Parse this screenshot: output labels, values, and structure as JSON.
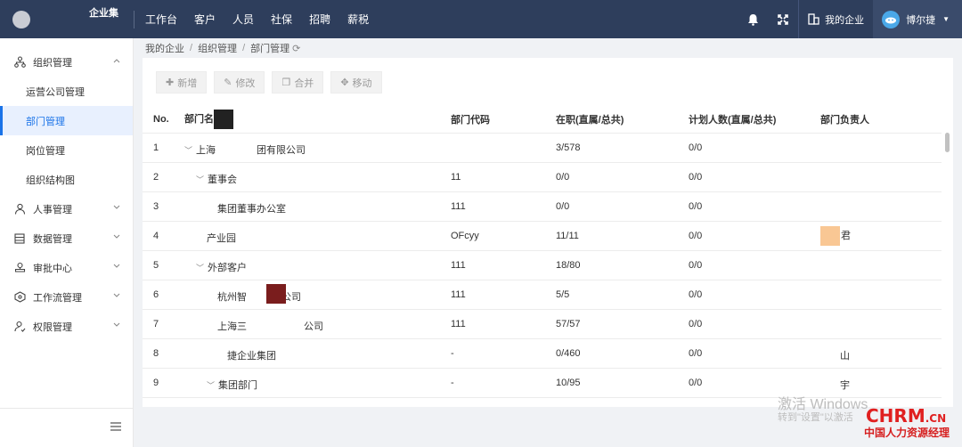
{
  "app": {
    "logo_text": "企业集"
  },
  "topnav": [
    "工作台",
    "客户",
    "人员",
    "社保",
    "招聘",
    "薪税"
  ],
  "header_right": {
    "company_label": "我的企业",
    "user_name": "博尔捷"
  },
  "sidebar": {
    "groups": [
      {
        "label": "组织管理",
        "icon": "org-icon",
        "expanded": true,
        "items": [
          "运营公司管理",
          "部门管理",
          "岗位管理",
          "组织结构图"
        ]
      },
      {
        "label": "人事管理",
        "icon": "person-icon"
      },
      {
        "label": "数据管理",
        "icon": "data-icon"
      },
      {
        "label": "审批中心",
        "icon": "approval-icon"
      },
      {
        "label": "工作流管理",
        "icon": "workflow-icon"
      },
      {
        "label": "权限管理",
        "icon": "permission-icon"
      }
    ],
    "active_item": "部门管理"
  },
  "breadcrumb": [
    "我的企业",
    "组织管理",
    "部门管理"
  ],
  "toolbar": {
    "add": "新增",
    "edit": "修改",
    "merge": "合并",
    "move": "移动"
  },
  "table": {
    "headers": [
      "No.",
      "部门名",
      "部门代码",
      "在职(直属/总共)",
      "计划人数(直属/总共)",
      "部门负责人"
    ],
    "rows": [
      {
        "no": "1",
        "name": "上海",
        "name2": "团有限公司",
        "code": "",
        "active": "3/578",
        "plan": "0/0",
        "leader": ""
      },
      {
        "no": "2",
        "name": "董事会",
        "code": "11",
        "active": "0/0",
        "plan": "0/0",
        "leader": ""
      },
      {
        "no": "3",
        "name": "集团董事办公室",
        "code": "111",
        "active": "0/0",
        "plan": "0/0",
        "leader": ""
      },
      {
        "no": "4",
        "name": "产业园",
        "code": "OFcyy",
        "active": "11/11",
        "plan": "0/0",
        "leader": "君"
      },
      {
        "no": "5",
        "name": "外部客户",
        "code": "111",
        "active": "18/80",
        "plan": "0/0",
        "leader": ""
      },
      {
        "no": "6",
        "name": "杭州智",
        "name2": "公司",
        "code": "111",
        "active": "5/5",
        "plan": "0/0",
        "leader": ""
      },
      {
        "no": "7",
        "name": "上海三",
        "name2": "公司",
        "code": "111",
        "active": "57/57",
        "plan": "0/0",
        "leader": ""
      },
      {
        "no": "8",
        "name": "捷企业集团",
        "code": "-",
        "active": "0/460",
        "plan": "0/0",
        "leader": "山"
      },
      {
        "no": "9",
        "name": "集团部门",
        "code": "-",
        "active": "10/95",
        "plan": "0/0",
        "leader": "宇"
      }
    ]
  },
  "watermark": {
    "line1": "激活 Windows",
    "line2": "转到\"设置\"以激活",
    "brand": "CHRM",
    "brand_suffix": ".CN",
    "brand_sub": "中国人力资源经理"
  }
}
